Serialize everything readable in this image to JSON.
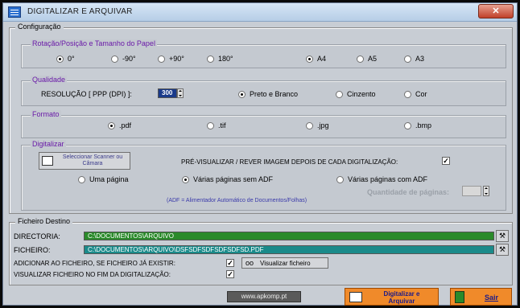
{
  "window": {
    "title": "DIGITALIZAR E ARQUIVAR",
    "close_label": "✕"
  },
  "config": {
    "legend": "Configuração",
    "rotation": {
      "label": "Rotação/Posição e Tamanho do Papel",
      "options": [
        "0°",
        "-90°",
        "+90°",
        "180°"
      ],
      "selected": "0°",
      "paper_options": [
        "A4",
        "A5",
        "A3"
      ],
      "paper_selected": "A4"
    },
    "quality": {
      "label": "Qualidade",
      "resolution_label": "RESOLUÇÃO [ PPP (DPI) ]:",
      "resolution_value": "300",
      "color_options": [
        "Preto e Branco",
        "Cinzento",
        "Cor"
      ],
      "color_selected": "Preto e Branco"
    },
    "format": {
      "label": "Formato",
      "options": [
        ".pdf",
        ".tif",
        ".jpg",
        ".bmp"
      ],
      "selected": ".pdf"
    },
    "scan": {
      "label": "Digitalizar",
      "select_button": "Seleccionar Scanner ou Câmara",
      "preview_label": "PRÉ-VISUALIZAR / REVER IMAGEM DEPOIS DE CADA DIGITALIZAÇÃO:",
      "preview_checked": true,
      "page_options": [
        "Uma página",
        "Várias páginas sem ADF",
        "Várias páginas com ADF"
      ],
      "page_selected": "Várias páginas sem ADF",
      "qty_label": "Quantidade de páginas:",
      "adf_note": "(ADF = Alimentador Automático de Documentos/Folhas)"
    }
  },
  "dest": {
    "legend": "Ficheiro Destino",
    "directory_label": "DIRECTORIA:",
    "directory_value": "C:\\DOCUMENTOS\\ARQUIVO",
    "file_label": "FICHEIRO:",
    "file_value": "C:\\DOCUMENTOS\\ARQUIVO\\DSFSDFSDFSDFSDFSD.PDF",
    "append_label": "ADICIONAR AO FICHEIRO, SE FICHEIRO JÁ EXISTIR:",
    "append_checked": true,
    "view_button": "Visualizar ficheiro",
    "view_end_label": "VISUALIZAR FICHEIRO NO FIM DA DIGITALIZAÇÃO:",
    "view_end_checked": true
  },
  "footer": {
    "website": "www.apkomp.pt",
    "scan_button": "Digitalizar e Arquivar",
    "exit_button": "Sair"
  },
  "colors": {
    "directory_bg": "#2a8a2a",
    "file_bg": "#1a8a8a",
    "group_label": "#6a1aa8",
    "accent_button": "#f08a2a"
  }
}
